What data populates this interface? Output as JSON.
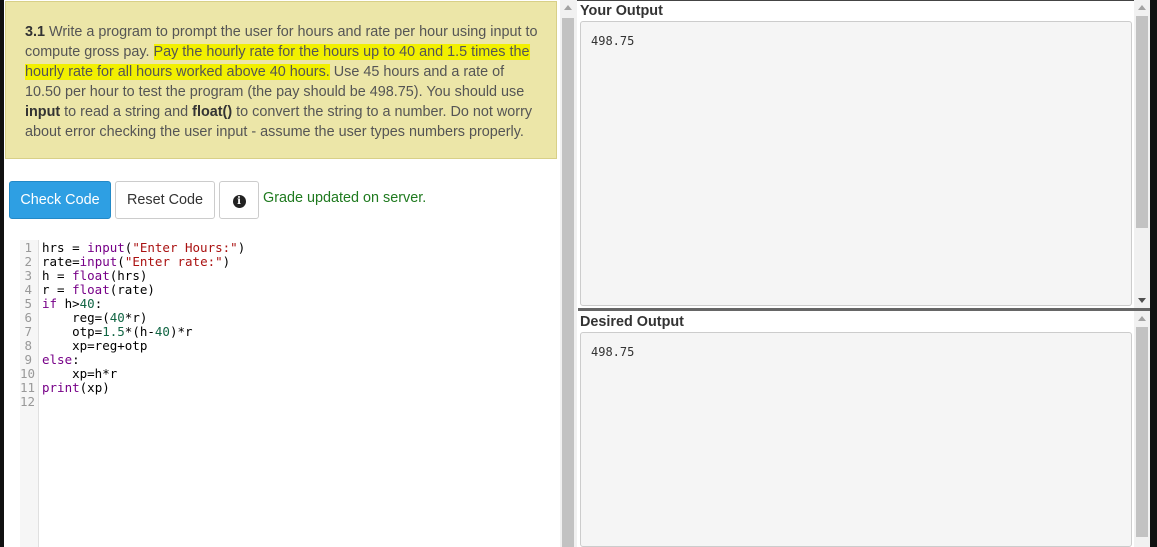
{
  "instructions": {
    "number": "3.1",
    "text_before": "Write a program to prompt the user for hours and rate per hour using input to compute gross pay.",
    "highlight": "Pay the hourly rate for the hours up to 40 and 1.5 times the hourly rate for all hours worked above 40 hours.",
    "text_mid1": "Use 45 hours and a rate of 10.50 per hour to test the program (the pay should be 498.75). You should use",
    "kw_input": "input",
    "text_mid2": "to read a string and",
    "kw_float": "float()",
    "text_after": "to convert the string to a number. Do not worry about error checking the user input - assume the user types numbers properly.",
    "highlight_color": "#f2f000",
    "background_color": "#ece6a8"
  },
  "toolbar": {
    "check_label": "Check Code",
    "reset_label": "Reset Code",
    "info_icon": "info-circle-icon",
    "info_glyph": "i",
    "status_text": "Grade updated on server.",
    "accent_color": "#2e9fe3",
    "status_color": "#1f7a1f"
  },
  "editor": {
    "lines": [
      {
        "n": "1"
      },
      {
        "n": "2"
      },
      {
        "n": "3"
      },
      {
        "n": "4"
      },
      {
        "n": "5"
      },
      {
        "n": "6"
      },
      {
        "n": "7"
      },
      {
        "n": "8"
      },
      {
        "n": "9"
      },
      {
        "n": "10"
      },
      {
        "n": "11"
      },
      {
        "n": "12"
      }
    ]
  },
  "your_output": {
    "title": "Your Output",
    "value": "498.75"
  },
  "desired_output": {
    "title": "Desired Output",
    "value": "498.75"
  }
}
